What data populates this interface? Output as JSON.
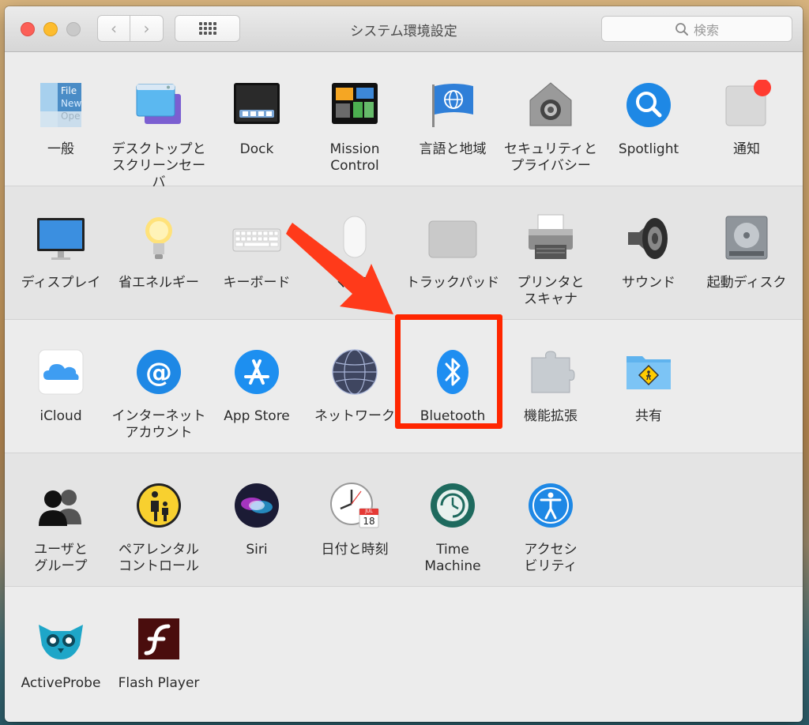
{
  "window": {
    "title": "システム環境設定",
    "search_placeholder": "検索",
    "back_label": "‹",
    "forward_label": "›"
  },
  "rows": [
    {
      "items": [
        {
          "label": "一般",
          "icon": "general-icon"
        },
        {
          "label": "デスクトップと\nスクリーンセーバ",
          "icon": "desktop-screensaver-icon"
        },
        {
          "label": "Dock",
          "icon": "dock-icon"
        },
        {
          "label": "Mission\nControl",
          "icon": "mission-control-icon"
        },
        {
          "label": "言語と地域",
          "icon": "language-region-icon"
        },
        {
          "label": "セキュリティと\nプライバシー",
          "icon": "security-privacy-icon"
        },
        {
          "label": "Spotlight",
          "icon": "spotlight-icon"
        },
        {
          "label": "通知",
          "icon": "notifications-icon"
        }
      ]
    },
    {
      "items": [
        {
          "label": "ディスプレイ",
          "icon": "display-icon"
        },
        {
          "label": "省エネルギー",
          "icon": "energy-saver-icon"
        },
        {
          "label": "キーボード",
          "icon": "keyboard-icon"
        },
        {
          "label": "マウス",
          "icon": "mouse-icon"
        },
        {
          "label": "トラックパッド",
          "icon": "trackpad-icon"
        },
        {
          "label": "プリンタと\nスキャナ",
          "icon": "printer-scanner-icon"
        },
        {
          "label": "サウンド",
          "icon": "sound-icon"
        },
        {
          "label": "起動ディスク",
          "icon": "startup-disk-icon"
        }
      ]
    },
    {
      "items": [
        {
          "label": "iCloud",
          "icon": "icloud-icon"
        },
        {
          "label": "インターネット\nアカウント",
          "icon": "internet-accounts-icon"
        },
        {
          "label": "App Store",
          "icon": "app-store-icon"
        },
        {
          "label": "ネットワーク",
          "icon": "network-icon"
        },
        {
          "label": "Bluetooth",
          "icon": "bluetooth-icon"
        },
        {
          "label": "機能拡張",
          "icon": "extensions-icon"
        },
        {
          "label": "共有",
          "icon": "sharing-icon"
        }
      ]
    },
    {
      "items": [
        {
          "label": "ユーザと\nグループ",
          "icon": "users-groups-icon"
        },
        {
          "label": "ペアレンタル\nコントロール",
          "icon": "parental-controls-icon"
        },
        {
          "label": "Siri",
          "icon": "siri-icon"
        },
        {
          "label": "日付と時刻",
          "icon": "date-time-icon"
        },
        {
          "label": "Time\nMachine",
          "icon": "time-machine-icon"
        },
        {
          "label": "アクセシ\nビリティ",
          "icon": "accessibility-icon"
        }
      ]
    },
    {
      "items": [
        {
          "label": "ActiveProbe",
          "icon": "activeprobe-icon"
        },
        {
          "label": "Flash Player",
          "icon": "flash-player-icon"
        }
      ]
    }
  ],
  "calendar": {
    "month": "JUL",
    "day": "18"
  },
  "general_icon_text": {
    "line1": "File",
    "line2": "New",
    "line3": "Ope"
  },
  "colors": {
    "highlight": "#ff2600",
    "arrow": "#ff3a1a",
    "accent_blue": "#1e88e5"
  }
}
